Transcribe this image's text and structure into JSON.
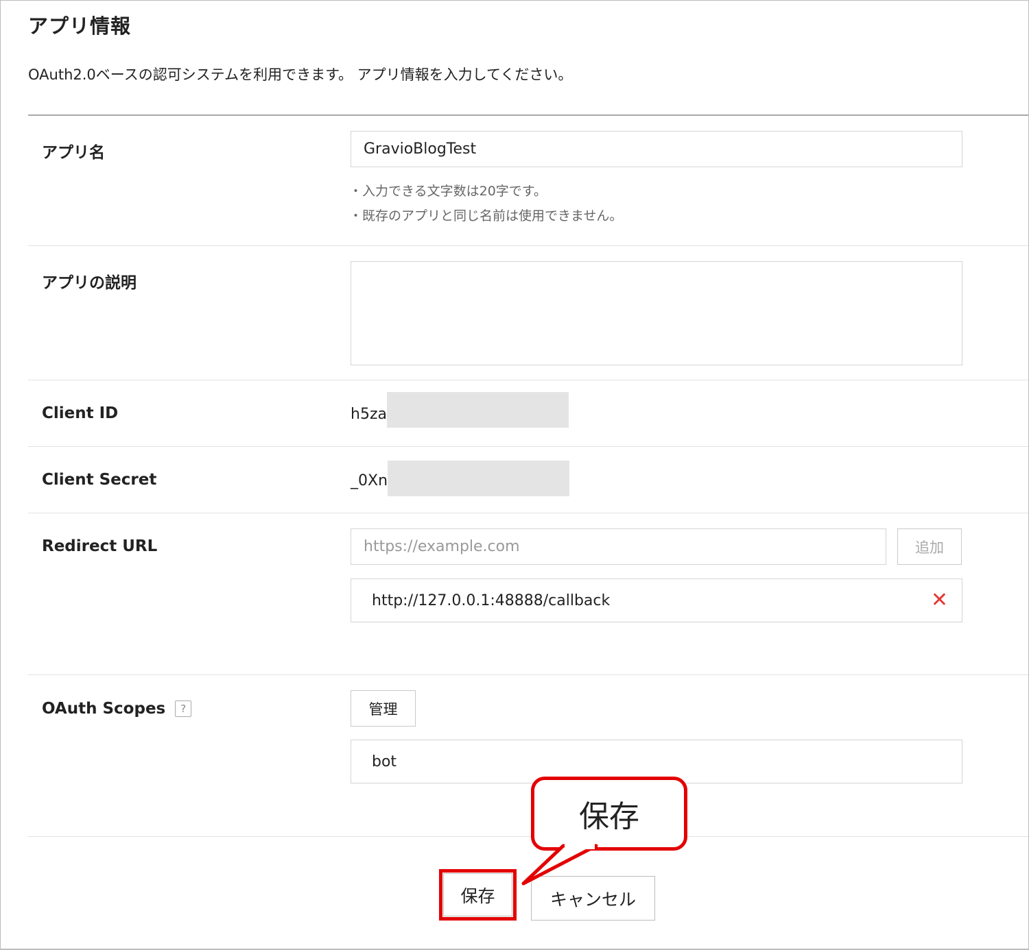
{
  "header": {
    "title": "アプリ情報",
    "description": "OAuth2.0ベースの認可システムを利用できます。 アプリ情報を入力してください。"
  },
  "form": {
    "app_name": {
      "label": "アプリ名",
      "value": "GravioBlogTest",
      "hints": [
        "・入力できる文字数は20字です。",
        "・既存のアプリと同じ名前は使用できません。"
      ]
    },
    "app_description": {
      "label": "アプリの説明",
      "value": ""
    },
    "client_id": {
      "label": "Client ID",
      "value": "h5za"
    },
    "client_secret": {
      "label": "Client Secret",
      "value": "_0Xn"
    },
    "redirect_url": {
      "label": "Redirect URL",
      "placeholder": "https://example.com",
      "add_label": "追加",
      "urls": [
        "http://127.0.0.1:48888/callback"
      ],
      "remove_icon": "close-icon"
    },
    "oauth_scopes": {
      "label": "OAuth Scopes",
      "help_icon": "question-icon",
      "help_glyph": "?",
      "manage_label": "管理",
      "scopes": [
        "bot"
      ]
    }
  },
  "actions": {
    "save_label": "保存",
    "cancel_label": "キャンセル"
  },
  "annotation": {
    "callout_text": "保存",
    "color": "#e30000"
  },
  "colors": {
    "remove": "#e53935",
    "annotation": "#e30000"
  }
}
